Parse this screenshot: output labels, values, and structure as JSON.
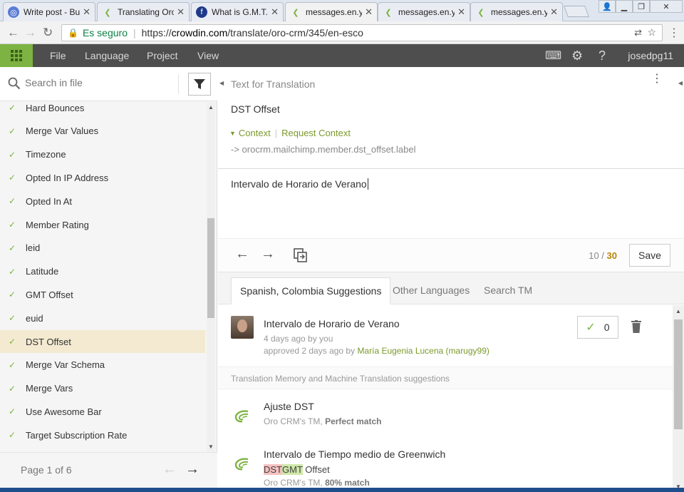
{
  "browser": {
    "tabs": [
      {
        "label": "Write post - Bu",
        "icon": "blogger-icon",
        "color": "#5a7bd6"
      },
      {
        "label": "Translating Oro",
        "icon": "crowdin-icon",
        "color": "#7cb342"
      },
      {
        "label": "What is G.M.T.",
        "icon": "globe-icon",
        "color": "#1e3a8a"
      },
      {
        "label": "messages.en.y",
        "icon": "crowdin-icon",
        "color": "#7cb342"
      },
      {
        "label": "messages.en.y",
        "icon": "crowdin-icon",
        "color": "#7cb342"
      },
      {
        "label": "messages.en.y",
        "icon": "crowdin-icon",
        "color": "#7cb342"
      }
    ],
    "secure_label": "Es seguro",
    "url_prefix": "https://",
    "url_host": "crowdin.com",
    "url_path": "/translate/oro-crm/345/en-esco"
  },
  "menubar": {
    "items": [
      "File",
      "Language",
      "Project",
      "View"
    ],
    "user": "josedpg11",
    "accent": "#7cb342"
  },
  "left": {
    "search_placeholder": "Search in file",
    "strings": [
      "Hard Bounces",
      "Merge Var Values",
      "Timezone",
      "Opted In IP Address",
      "Opted In At",
      "Member Rating",
      "leid",
      "Latitude",
      "GMT Offset",
      "euid",
      "DST Offset",
      "Merge Var Schema",
      "Merge Vars",
      "Use Awesome Bar",
      "Target Subscription Rate"
    ],
    "selected_index": 10,
    "page_label": "Page 1 of 6"
  },
  "editor": {
    "title": "Text for Translation",
    "source": "DST Offset",
    "context_label": "Context",
    "request_context": "Request Context",
    "context_key": "-> orocrm.mailchimp.member.dst_offset.label",
    "translation": "Intervalo de Horario de Verano",
    "counter_current": "10",
    "counter_sep": " / ",
    "counter_total": "30",
    "save_label": "Save"
  },
  "suggest_tabs": [
    "Spanish, Colombia Suggestions",
    "Other Languages",
    "Search TM"
  ],
  "suggestion": {
    "text": "Intervalo de Horario de Verano",
    "meta1": "4 days ago by you",
    "meta2_prefix": "approved 2 days ago by ",
    "meta2_user": "María Eugenia Lucena (marugy99)",
    "votes": "0"
  },
  "tm": {
    "header": "Translation Memory and Machine Translation suggestions",
    "items": [
      {
        "text": "Ajuste DST",
        "source_prefix": "Oro CRM's TM, ",
        "source_match": "Perfect match"
      },
      {
        "text": "Intervalo de Tiempo medio de Greenwich",
        "diff_del": "DST",
        "diff_ins": "GMT",
        "diff_rest": " Offset",
        "source_prefix": "Oro CRM's TM, ",
        "source_match": "80% match"
      }
    ]
  }
}
